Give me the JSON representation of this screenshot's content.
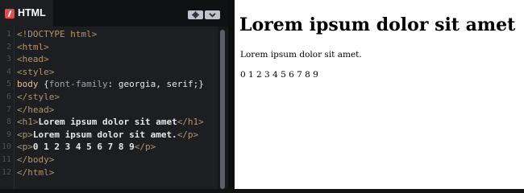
{
  "editor": {
    "tab_label": "HTML",
    "colors": {
      "logo": "#e54b4b",
      "tag": "#b0956b",
      "text": "#e8e8e8"
    },
    "icons": {
      "settings": "gear-icon",
      "collapse": "chevron-down-icon"
    },
    "lines": [
      {
        "n": "1",
        "tokens": [
          {
            "c": "tag",
            "t": "<!DOCTYPE html>"
          }
        ]
      },
      {
        "n": "2",
        "tokens": [
          {
            "c": "tag",
            "t": "<html>"
          }
        ]
      },
      {
        "n": "3",
        "tokens": [
          {
            "c": "tag",
            "t": "<head>"
          }
        ]
      },
      {
        "n": "4",
        "tokens": [
          {
            "c": "tag",
            "t": "<style>"
          }
        ]
      },
      {
        "n": "5",
        "tokens": [
          {
            "c": "sel",
            "t": "body "
          },
          {
            "c": "punc",
            "t": "{"
          },
          {
            "c": "prop",
            "t": "font-family"
          },
          {
            "c": "punc",
            "t": ": "
          },
          {
            "c": "val",
            "t": "georgia"
          },
          {
            "c": "punc",
            "t": ", "
          },
          {
            "c": "val",
            "t": "serif"
          },
          {
            "c": "punc",
            "t": ";}"
          }
        ]
      },
      {
        "n": "6",
        "tokens": [
          {
            "c": "tag",
            "t": "</style>"
          }
        ]
      },
      {
        "n": "7",
        "tokens": [
          {
            "c": "tag",
            "t": "</head>"
          }
        ]
      },
      {
        "n": "8",
        "tokens": [
          {
            "c": "tag",
            "t": "<h1>"
          },
          {
            "c": "txt",
            "t": "Lorem ipsum dolor sit amet"
          },
          {
            "c": "tag",
            "t": "</h1>"
          }
        ]
      },
      {
        "n": "9",
        "tokens": [
          {
            "c": "tag",
            "t": "<p>"
          },
          {
            "c": "txt",
            "t": "Lorem ipsum dolor sit amet."
          },
          {
            "c": "tag",
            "t": "</p>"
          }
        ]
      },
      {
        "n": "10",
        "tokens": [
          {
            "c": "tag",
            "t": "<p>"
          },
          {
            "c": "txt",
            "t": "0 1 2 3 4 5 6 7 8 9"
          },
          {
            "c": "tag",
            "t": "</p>"
          }
        ]
      },
      {
        "n": "11",
        "tokens": [
          {
            "c": "tag",
            "t": "</body>"
          }
        ]
      },
      {
        "n": "12",
        "tokens": [
          {
            "c": "tag",
            "t": "</html>"
          }
        ]
      }
    ]
  },
  "preview": {
    "heading": "Lorem ipsum dolor sit amet",
    "paragraph": "Lorem ipsum dolor sit amet.",
    "digits": "0 1 2 3 4 5 6 7 8 9"
  }
}
